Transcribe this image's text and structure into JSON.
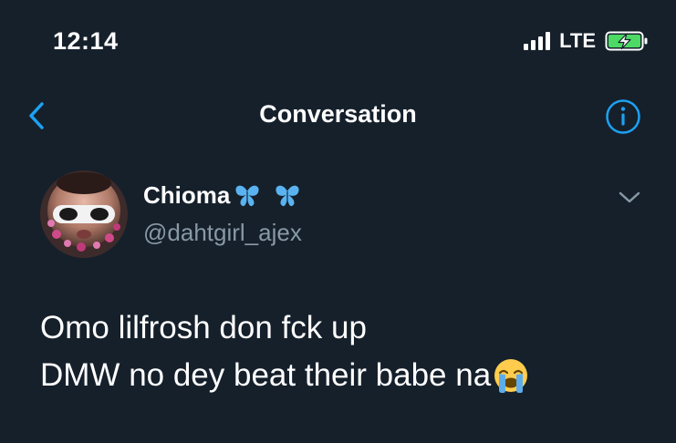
{
  "status_bar": {
    "time": "12:14",
    "network": "LTE"
  },
  "nav": {
    "title": "Conversation",
    "back_icon": "chevron-left-icon",
    "info_icon": "info-circle-icon"
  },
  "tweet": {
    "author": {
      "display_name": "Chioma",
      "name_emojis": [
        "butterfly-icon",
        "butterfly-icon"
      ],
      "handle": "@dahtgirl_ajex"
    },
    "lines": [
      "Omo lilfrosh don fck up",
      "DMW no dey beat their babe na"
    ],
    "trailing_emoji": "loudly-crying-face-icon"
  },
  "colors": {
    "background": "#15202b",
    "accent": "#1da1f2",
    "secondary_text": "#8899a6",
    "battery_green": "#4cd964"
  }
}
